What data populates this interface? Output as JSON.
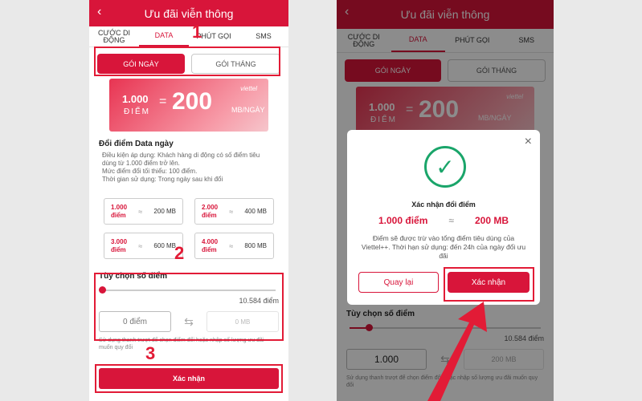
{
  "header": {
    "title": "Ưu đãi viễn thông",
    "back": "‹"
  },
  "tabs": [
    "CƯỚC DI ĐỘNG",
    "DATA",
    "PHÚT GỌI",
    "SMS"
  ],
  "segment": {
    "day": "GÓI NGÀY",
    "month": "GÓI THÁNG"
  },
  "banner": {
    "brand": "viettel",
    "points": "1.000",
    "points_label": "ĐIỂM",
    "eq": "=",
    "amount": "200",
    "unit": "MB/NGÀY"
  },
  "section": {
    "title": "Đổi điểm Data ngày",
    "desc": "Điều kiện áp dụng: Khách hàng di động có số điểm tiêu dùng từ 1.000 điểm trở lên.\nMức điểm đổi tối thiểu: 100 điểm.\nThời gian sử dụng: Trong ngày sau khi đổi"
  },
  "options": [
    {
      "points": "1.000\nđiểm",
      "sym": "≈",
      "mb": "200 MB"
    },
    {
      "points": "2.000\nđiểm",
      "sym": "≈",
      "mb": "400 MB"
    },
    {
      "points": "3.000\nđiểm",
      "sym": "≈",
      "mb": "600 MB"
    },
    {
      "points": "4.000\nđiểm",
      "sym": "≈",
      "mb": "800 MB"
    }
  ],
  "custom": {
    "title": "Tùy chọn số điểm",
    "max": "10.584 điểm",
    "input_placeholder": "0 điểm",
    "output_placeholder": "0 MB",
    "swap": "⇆",
    "hint": "Sử dụng thanh trượt để chọn điểm đổi hoặc nhập số lượng ưu đãi muốn quy đổi"
  },
  "right_custom": {
    "input_value": "1.000",
    "output_value": "200 MB"
  },
  "slider": {
    "left_level": 0.0,
    "right_level": 0.1
  },
  "cta": "Xác nhận",
  "annotations": [
    "1",
    "2",
    "3"
  ],
  "modal": {
    "close": "×",
    "check": "✓",
    "title": "Xác nhận đổi điểm",
    "from": "1.000 điểm",
    "sym": "≈",
    "to": "200 MB",
    "desc": "Điểm sẽ được trừ vào tổng điểm tiêu dùng của Viettel++. Thời hạn sử dụng: đến 24h của ngày đổi ưu đãi",
    "back": "Quay lại",
    "confirm": "Xác nhận"
  },
  "colors": {
    "brand": "#d8153a",
    "success": "#1aa56a",
    "annotation": "#e21b36"
  }
}
